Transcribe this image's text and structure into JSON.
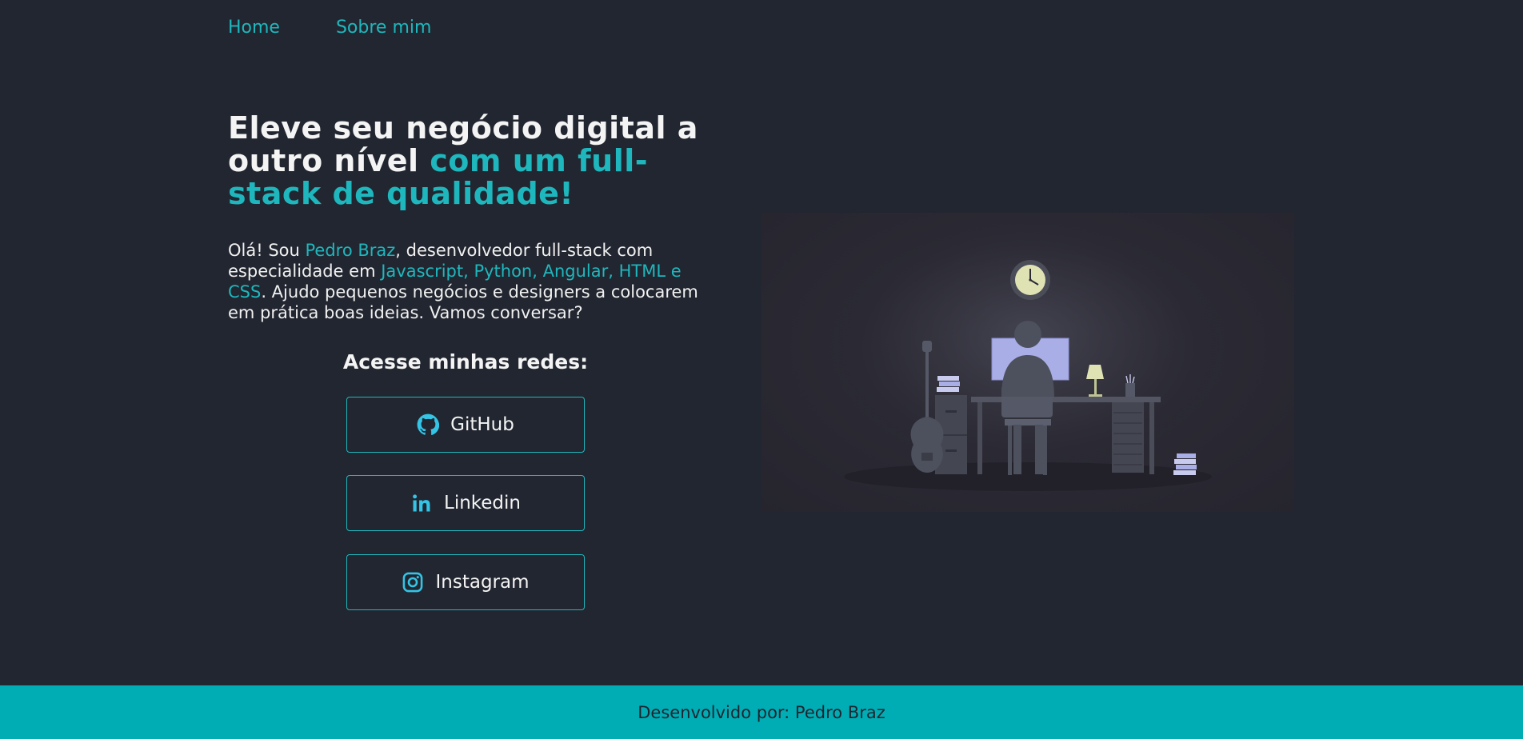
{
  "nav": {
    "items": [
      {
        "label": "Home"
      },
      {
        "label": "Sobre mim"
      }
    ]
  },
  "hero": {
    "title_part1": "Eleve seu negócio digital a outro nível ",
    "title_part2": "com um full-stack de qualidade!",
    "intro": {
      "part1": "Olá! Sou ",
      "name": "Pedro Braz",
      "part2": ", desenvolvedor full-stack com especialidade em ",
      "skills": "Javascript, Python, Angular, HTML e CSS",
      "part3": ". Ajudo pequenos negócios e designers a colocarem em prática boas ideias. Vamos conversar?"
    }
  },
  "networks": {
    "title": "Acesse minhas redes:",
    "buttons": [
      {
        "label": "GitHub",
        "icon": "github-icon"
      },
      {
        "label": "Linkedin",
        "icon": "linkedin-icon"
      },
      {
        "label": "Instagram",
        "icon": "instagram-icon"
      }
    ]
  },
  "illustration": {
    "subject": "developer-at-desk-illustration"
  },
  "footer": {
    "text": "Desenvolvido por: Pedro Braz"
  },
  "colors": {
    "background": "#222630",
    "accent": "#1eb7bd",
    "footer": "#00adb5"
  }
}
